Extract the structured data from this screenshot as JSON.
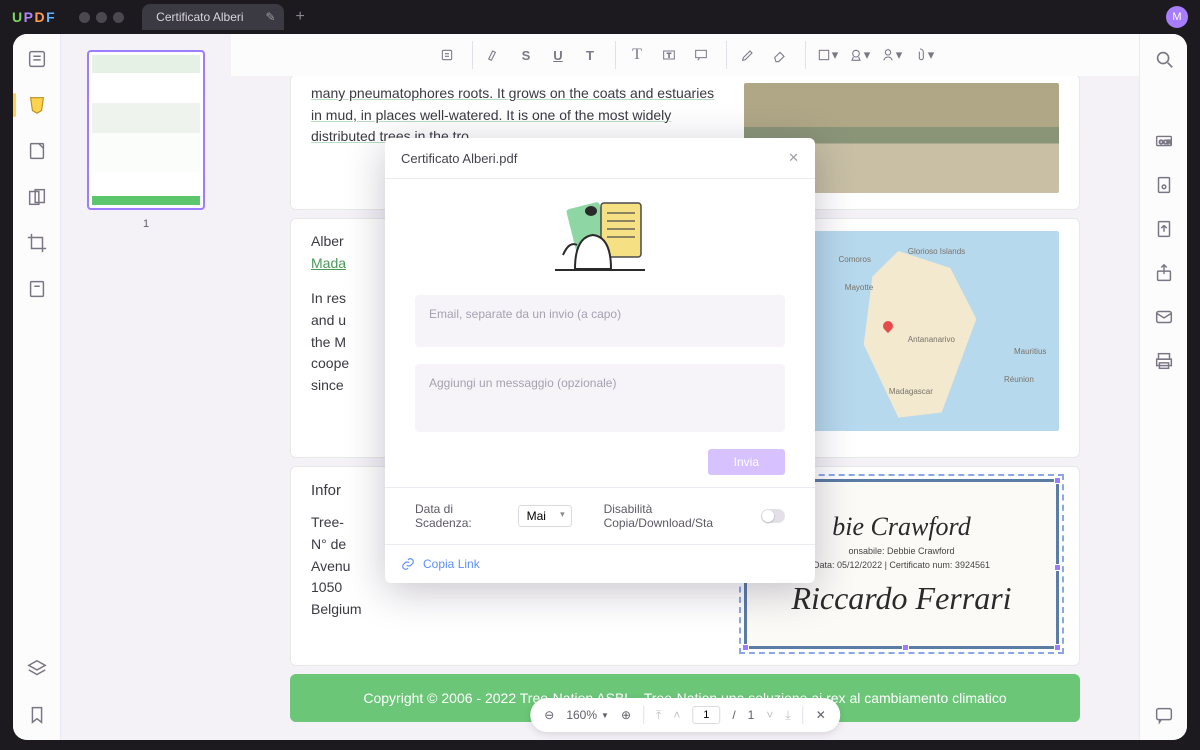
{
  "app": {
    "logo": "UPDF",
    "tab_title": "Certificato Alberi",
    "avatar_initial": "M"
  },
  "thumbnails": {
    "page_number": "1"
  },
  "document": {
    "section1_text": "many pneumatophores roots. It grows on the coats and estuaries in mud, in places well-watered. It is one of the most widely distributed trees in the tro...",
    "section2_prefix": "Alber",
    "section2_link": "Mada",
    "section2_body": "In res\nand u\nthe M\ncoope\nsince",
    "info_title": "Infor",
    "info_lines": "Tree-\nN° de\nAvenu\n1050\nBelgium",
    "map": {
      "l1": "Comoros",
      "l2": "Glorioso Islands",
      "l3": "Mayotte",
      "l4": "Antananarivo",
      "l5": "Madagascar",
      "l6": "Mauritius",
      "l7": "Réunion"
    },
    "cert": {
      "sig1": "bie Crawford",
      "line1": "onsabile: Debbie Crawford",
      "line2": "Data: 05/12/2022 | Certificato num: 3924561",
      "sig2": "Riccardo Ferrari"
    },
    "footer": "Copyright © 2006 - 2022 Tree-Nation ASBL · Tree-Nation una soluzione ai rex al cambiamento climatico"
  },
  "pagectl": {
    "zoom": "160%",
    "current": "1",
    "slash": "/",
    "total": "1"
  },
  "modal": {
    "title": "Certificato Alberi.pdf",
    "email_placeholder": "Email, separate da un invio (a capo)",
    "message_placeholder": "Aggiungi un messaggio (opzionale)",
    "send": "Invia",
    "expiry_label": "Data di Scadenza:",
    "expiry_value": "Mai",
    "disable_label": "Disabilità Copia/Download/Sta",
    "copy_link": "Copia Link"
  }
}
